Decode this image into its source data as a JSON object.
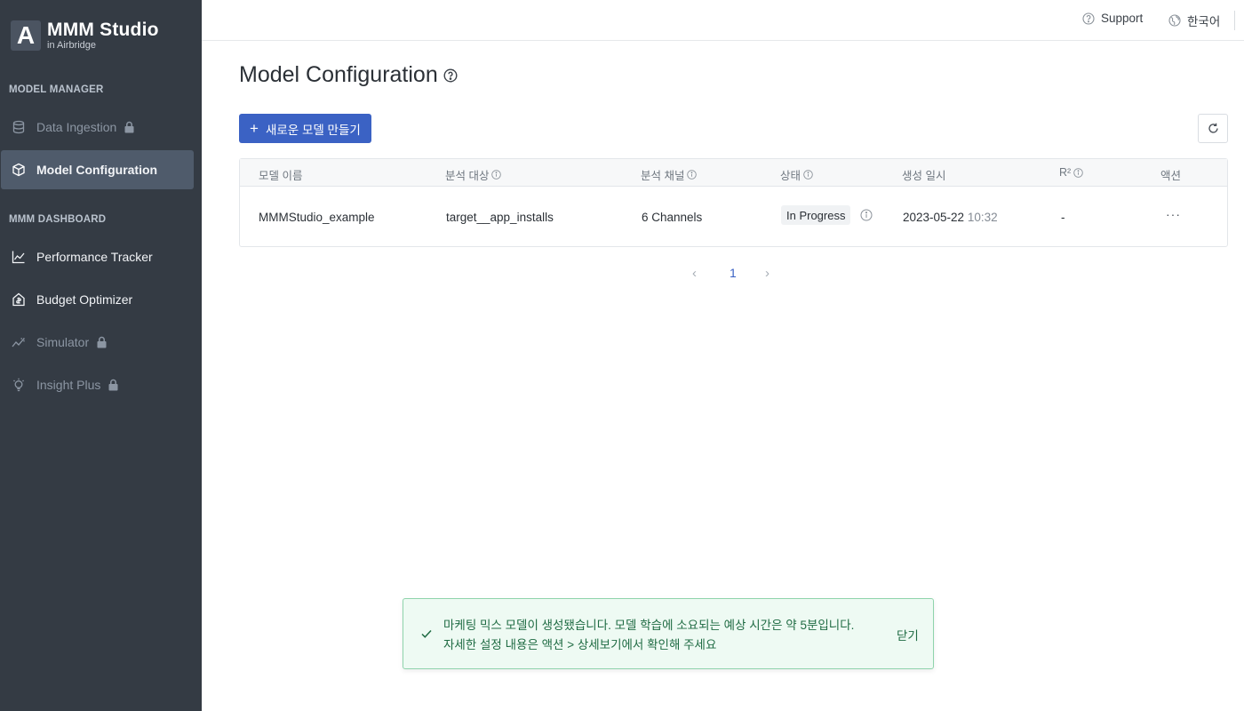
{
  "brand": {
    "logo_letter": "A",
    "name": "MMM Studio",
    "subtitle": "in Airbridge"
  },
  "sidebar": {
    "sections": [
      {
        "label": "MODEL MANAGER"
      },
      {
        "label": "MMM DASHBOARD"
      }
    ],
    "items": [
      {
        "label": "Data Ingestion",
        "icon": "database-icon",
        "locked": true
      },
      {
        "label": "Model Configuration",
        "icon": "cube-icon",
        "active": true
      },
      {
        "label": "Performance Tracker",
        "icon": "line-chart-icon"
      },
      {
        "label": "Budget Optimizer",
        "icon": "budget-icon"
      },
      {
        "label": "Simulator",
        "icon": "trend-icon",
        "locked": true
      },
      {
        "label": "Insight Plus",
        "icon": "lightbulb-icon",
        "locked": true
      }
    ]
  },
  "topbar": {
    "support_label": "Support",
    "language_label": "한국어"
  },
  "main": {
    "title": "Model Configuration",
    "create_button_label": "새로운 모델 만들기",
    "table": {
      "columns": [
        "모델 이름",
        "분석 대상",
        "분석 채널",
        "상태",
        "생성 일시",
        "R²",
        "액션"
      ],
      "rows": [
        {
          "name": "MMMStudio_example",
          "target": "target__app_installs",
          "channels": "6 Channels",
          "status": "In Progress",
          "date": "2023-05-22",
          "time": "10:32",
          "r2": "-",
          "action": "···"
        }
      ]
    },
    "pagination": {
      "prev": "‹",
      "current": "1",
      "next": "›"
    }
  },
  "toast": {
    "line1": "마케팅 믹스 모델이 생성됐습니다. 모델 학습에 소요되는 예상 시간은 약 5분입니다.",
    "line2": "자세한 설정 내용은 액션 > 상세보기에서 확인해 주세요",
    "close_label": "닫기"
  },
  "colors": {
    "sidebar_bg": "#343b44",
    "primary": "#3b62c4",
    "toast_bg": "#eefaf3",
    "toast_border": "#8fd4ac",
    "toast_text": "#1f6b43"
  }
}
